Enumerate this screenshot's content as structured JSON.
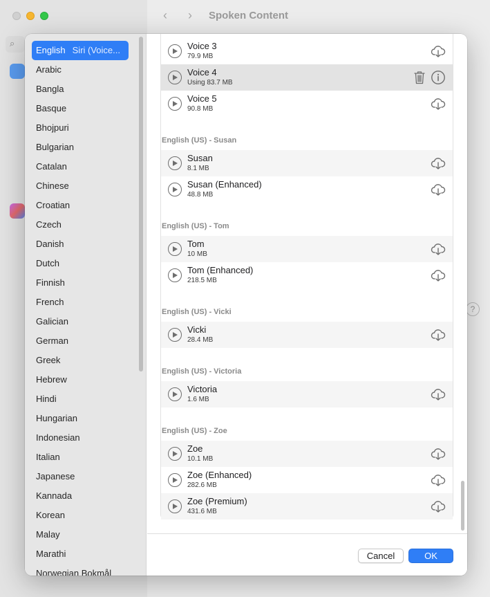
{
  "window": {
    "title": "Spoken Content",
    "back_glyph": "‹",
    "forward_glyph": "›",
    "help_glyph": "?"
  },
  "languages": {
    "selected": {
      "label": "English",
      "sub": "Siri (Voice..."
    },
    "items": [
      "Arabic",
      "Bangla",
      "Basque",
      "Bhojpuri",
      "Bulgarian",
      "Catalan",
      "Chinese",
      "Croatian",
      "Czech",
      "Danish",
      "Dutch",
      "Finnish",
      "French",
      "Galician",
      "German",
      "Greek",
      "Hebrew",
      "Hindi",
      "Hungarian",
      "Indonesian",
      "Italian",
      "Japanese",
      "Kannada",
      "Korean",
      "Malay",
      "Marathi",
      "Norwegian Bokmål"
    ]
  },
  "voices": {
    "top": [
      {
        "name": "Voice 3",
        "size": "79.9 MB"
      },
      {
        "name": "Voice 4",
        "size": "Using 83.7 MB"
      },
      {
        "name": "Voice 5",
        "size": "90.8 MB"
      }
    ],
    "groups": [
      {
        "header": "English (US) - Susan",
        "items": [
          {
            "name": "Susan",
            "size": "8.1 MB"
          },
          {
            "name": "Susan (Enhanced)",
            "size": "48.8 MB"
          }
        ]
      },
      {
        "header": "English (US) - Tom",
        "items": [
          {
            "name": "Tom",
            "size": "10 MB"
          },
          {
            "name": "Tom (Enhanced)",
            "size": "218.5 MB"
          }
        ]
      },
      {
        "header": "English (US) - Vicki",
        "items": [
          {
            "name": "Vicki",
            "size": "28.4 MB"
          }
        ]
      },
      {
        "header": "English (US) - Victoria",
        "items": [
          {
            "name": "Victoria",
            "size": "1.6 MB"
          }
        ]
      },
      {
        "header": "English (US) - Zoe",
        "items": [
          {
            "name": "Zoe",
            "size": "10.1 MB"
          },
          {
            "name": "Zoe (Enhanced)",
            "size": "282.6 MB"
          },
          {
            "name": "Zoe (Premium)",
            "size": "431.6 MB"
          }
        ]
      }
    ]
  },
  "footer": {
    "cancel_label": "Cancel",
    "ok_label": "OK"
  },
  "colors": {
    "accent": "#2f7ef6",
    "icon": "#6e6e6e"
  },
  "icons": {
    "play": "play-icon",
    "download": "cloud-download-icon",
    "delete": "trash-icon",
    "info": "info-icon"
  }
}
